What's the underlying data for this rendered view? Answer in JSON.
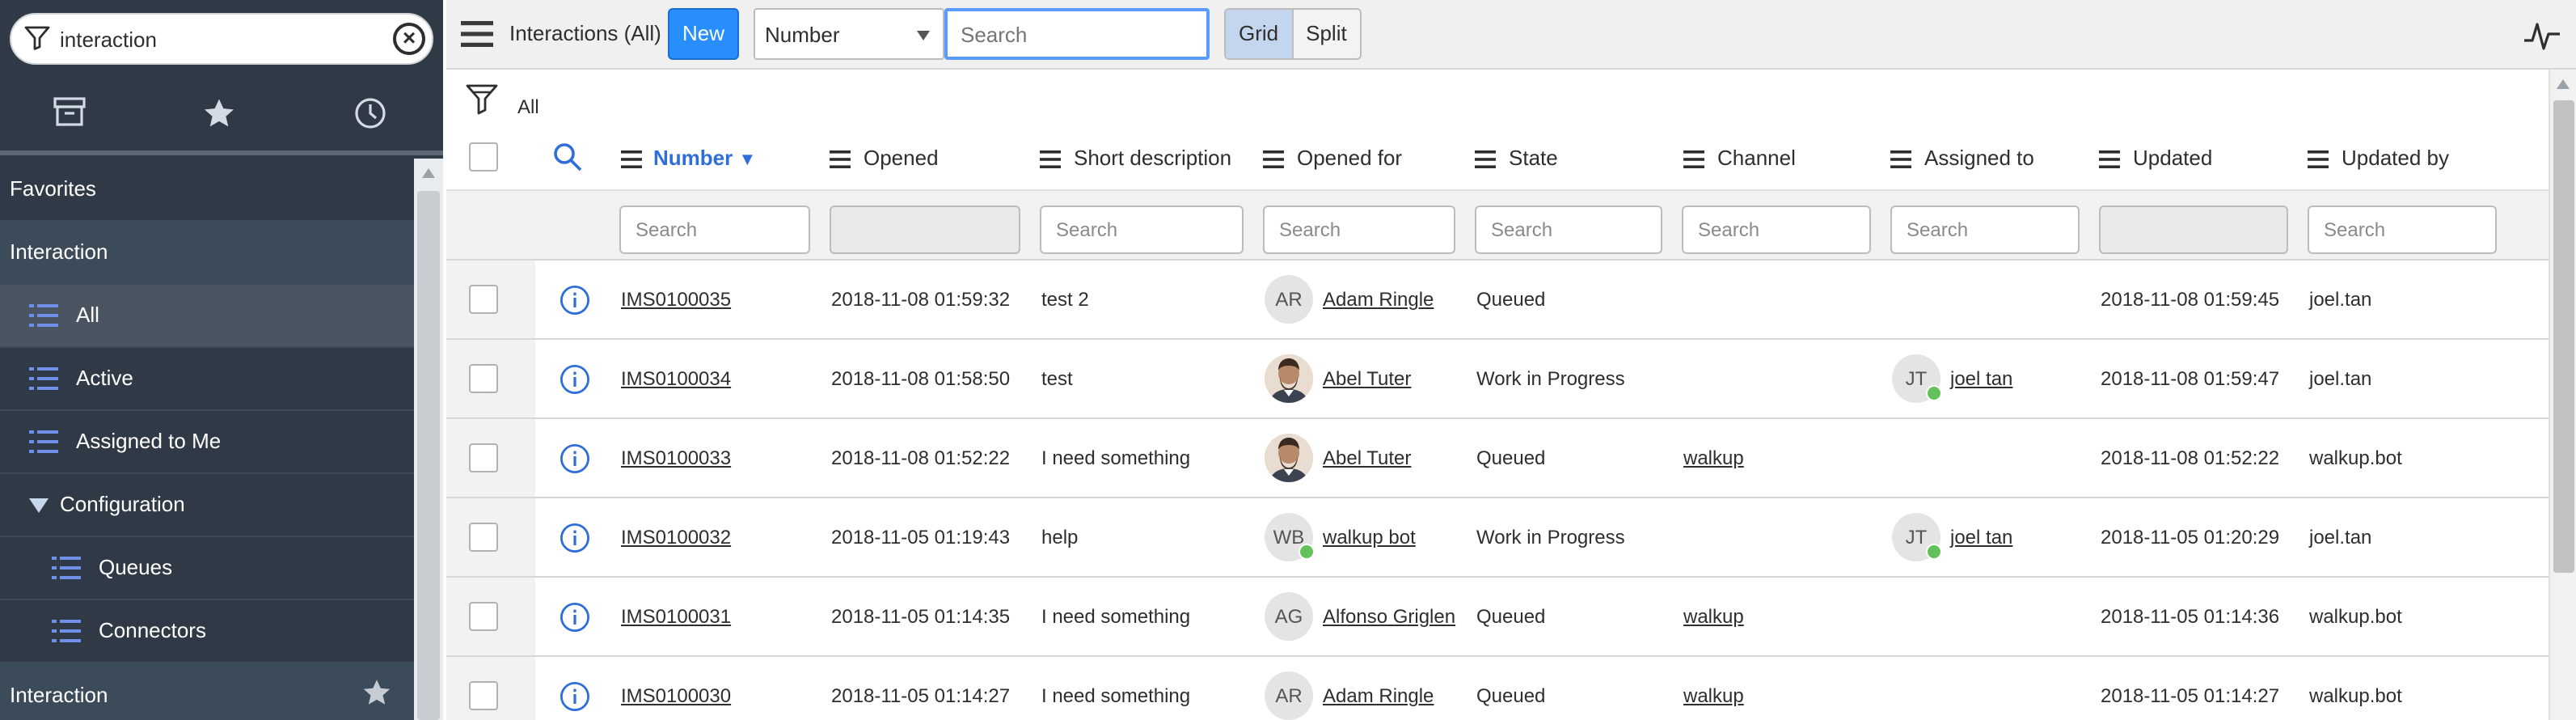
{
  "sidebar": {
    "filter_value": "interaction",
    "tabs": [
      {
        "icon": "archive-icon"
      },
      {
        "icon": "star-icon"
      },
      {
        "icon": "clock-icon"
      }
    ],
    "favorites_label": "Favorites",
    "app_label": "Interaction",
    "modules": {
      "all": "All",
      "active": "Active",
      "assigned_to_me": "Assigned to Me",
      "configuration": "Configuration",
      "queues": "Queues",
      "connectors": "Connectors"
    },
    "next_app_label": "Interaction"
  },
  "header": {
    "title": "Interactions (All)",
    "new_label": "New",
    "field_select": "Number",
    "search_placeholder": "Search",
    "view_grid": "Grid",
    "view_split": "Split"
  },
  "breadcrumb": {
    "label": "All"
  },
  "columns": {
    "number": "Number",
    "opened": "Opened",
    "short_description": "Short description",
    "opened_for": "Opened for",
    "state": "State",
    "channel": "Channel",
    "assigned_to": "Assigned to",
    "updated": "Updated",
    "updated_by": "Updated by"
  },
  "column_search_placeholder": "Search",
  "rows": [
    {
      "number": "IMS0100035",
      "opened": "2018-11-08 01:59:32",
      "short_description": "test 2",
      "opened_for": {
        "initials": "AR",
        "name": "Adam Ringle",
        "photo": false,
        "online": false
      },
      "state": "Queued",
      "channel": "",
      "assigned_to": {
        "initials": "",
        "name": "",
        "online": false
      },
      "updated": "2018-11-08 01:59:45",
      "updated_by": "joel.tan"
    },
    {
      "number": "IMS0100034",
      "opened": "2018-11-08 01:58:50",
      "short_description": "test",
      "opened_for": {
        "initials": "",
        "name": "Abel Tuter",
        "photo": true,
        "online": false
      },
      "state": "Work in Progress",
      "channel": "",
      "assigned_to": {
        "initials": "JT",
        "name": "joel tan",
        "online": true
      },
      "updated": "2018-11-08 01:59:47",
      "updated_by": "joel.tan"
    },
    {
      "number": "IMS0100033",
      "opened": "2018-11-08 01:52:22",
      "short_description": "I need something",
      "opened_for": {
        "initials": "",
        "name": "Abel Tuter",
        "photo": true,
        "online": false
      },
      "state": "Queued",
      "channel": "walkup",
      "assigned_to": {
        "initials": "",
        "name": "",
        "online": false
      },
      "updated": "2018-11-08 01:52:22",
      "updated_by": "walkup.bot"
    },
    {
      "number": "IMS0100032",
      "opened": "2018-11-05 01:19:43",
      "short_description": "help",
      "opened_for": {
        "initials": "WB",
        "name": "walkup bot",
        "photo": false,
        "online": true
      },
      "state": "Work in Progress",
      "channel": "",
      "assigned_to": {
        "initials": "JT",
        "name": "joel tan",
        "online": true
      },
      "updated": "2018-11-05 01:20:29",
      "updated_by": "joel.tan"
    },
    {
      "number": "IMS0100031",
      "opened": "2018-11-05 01:14:35",
      "short_description": "I need something",
      "opened_for": {
        "initials": "AG",
        "name": "Alfonso Griglen",
        "photo": false,
        "online": false
      },
      "state": "Queued",
      "channel": "walkup",
      "assigned_to": {
        "initials": "",
        "name": "",
        "online": false
      },
      "updated": "2018-11-05 01:14:36",
      "updated_by": "walkup.bot"
    },
    {
      "number": "IMS0100030",
      "opened": "2018-11-05 01:14:27",
      "short_description": "I need something",
      "opened_for": {
        "initials": "AR",
        "name": "Adam Ringle",
        "photo": false,
        "online": false
      },
      "state": "Queued",
      "channel": "walkup",
      "assigned_to": {
        "initials": "",
        "name": "",
        "online": false
      },
      "updated": "2018-11-05 01:14:27",
      "updated_by": "walkup.bot"
    }
  ],
  "colors": {
    "sidebar_bg": "#303a46",
    "primary_button": "#278efc",
    "sorted_column": "#2f6ddb",
    "info_icon": "#2f6ddb",
    "online_dot": "#62c15a"
  }
}
